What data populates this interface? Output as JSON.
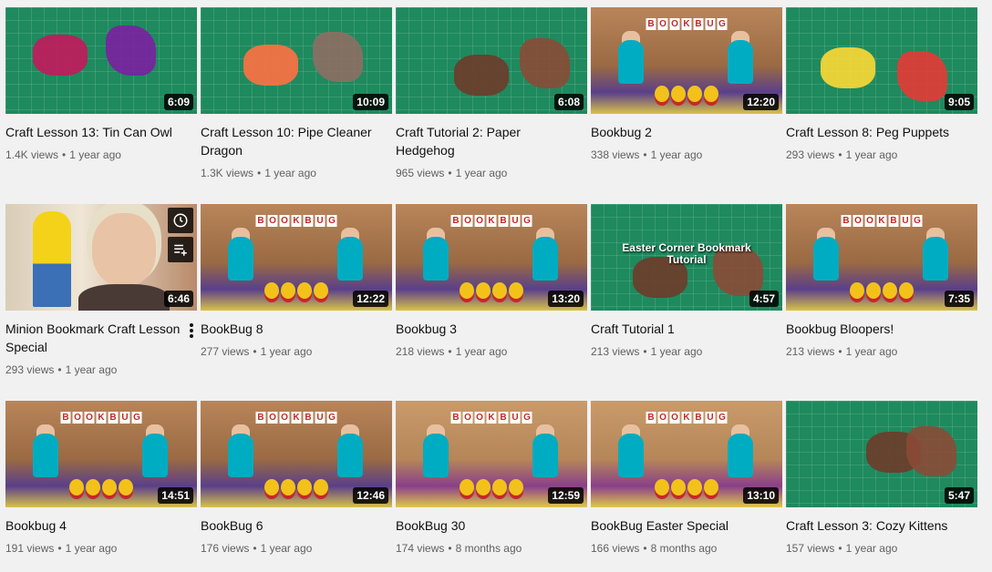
{
  "videos": [
    {
      "title": "Craft Lesson 13: Tin Can Owl",
      "views": "1.4K views",
      "age": "1 year ago",
      "duration": "6:09",
      "scene": "mat"
    },
    {
      "title": "Craft Lesson 10: Pipe Cleaner Dragon",
      "views": "1.3K views",
      "age": "1 year ago",
      "duration": "10:09",
      "scene": "mat"
    },
    {
      "title": "Craft Tutorial 2: Paper Hedgehog",
      "views": "965 views",
      "age": "1 year ago",
      "duration": "6:08",
      "scene": "mat"
    },
    {
      "title": "Bookbug 2",
      "views": "338 views",
      "age": "1 year ago",
      "duration": "12:20",
      "scene": "room"
    },
    {
      "title": "Craft Lesson 8: Peg Puppets",
      "views": "293 views",
      "age": "1 year ago",
      "duration": "9:05",
      "scene": "mat"
    },
    {
      "title": "Minion Bookmark Craft Lesson Special",
      "views": "293 views",
      "age": "1 year ago",
      "duration": "6:46",
      "scene": "person"
    },
    {
      "title": "BookBug 8",
      "views": "277 views",
      "age": "1 year ago",
      "duration": "12:22",
      "scene": "room"
    },
    {
      "title": "Bookbug 3",
      "views": "218 views",
      "age": "1 year ago",
      "duration": "13:20",
      "scene": "room"
    },
    {
      "title": "Craft Tutorial 1",
      "views": "213 views",
      "age": "1 year ago",
      "duration": "4:57",
      "scene": "mat",
      "overlay": "Easter Corner Bookmark Tutorial"
    },
    {
      "title": "Bookbug Bloopers!",
      "views": "213 views",
      "age": "1 year ago",
      "duration": "7:35",
      "scene": "room"
    },
    {
      "title": "Bookbug 4",
      "views": "191 views",
      "age": "1 year ago",
      "duration": "14:51",
      "scene": "room"
    },
    {
      "title": "BookBug 6",
      "views": "176 views",
      "age": "1 year ago",
      "duration": "12:46",
      "scene": "room"
    },
    {
      "title": "BookBug 30",
      "views": "174 views",
      "age": "8 months ago",
      "duration": "12:59",
      "scene": "room2"
    },
    {
      "title": "BookBug Easter Special",
      "views": "166 views",
      "age": "8 months ago",
      "duration": "13:10",
      "scene": "room2"
    },
    {
      "title": "Craft Lesson 3: Cozy Kittens",
      "views": "157 views",
      "age": "1 year ago",
      "duration": "5:47",
      "scene": "mat"
    }
  ],
  "banner_text": "BOOKBUG",
  "separator": "•",
  "colors": {
    "page_bg": "#f1f1f1",
    "meta_text": "#606060",
    "duration_bg": "#000000"
  },
  "icons": {
    "watch_later": "clock-icon",
    "add_to_queue": "queue-icon",
    "menu": "more-vert-icon"
  }
}
